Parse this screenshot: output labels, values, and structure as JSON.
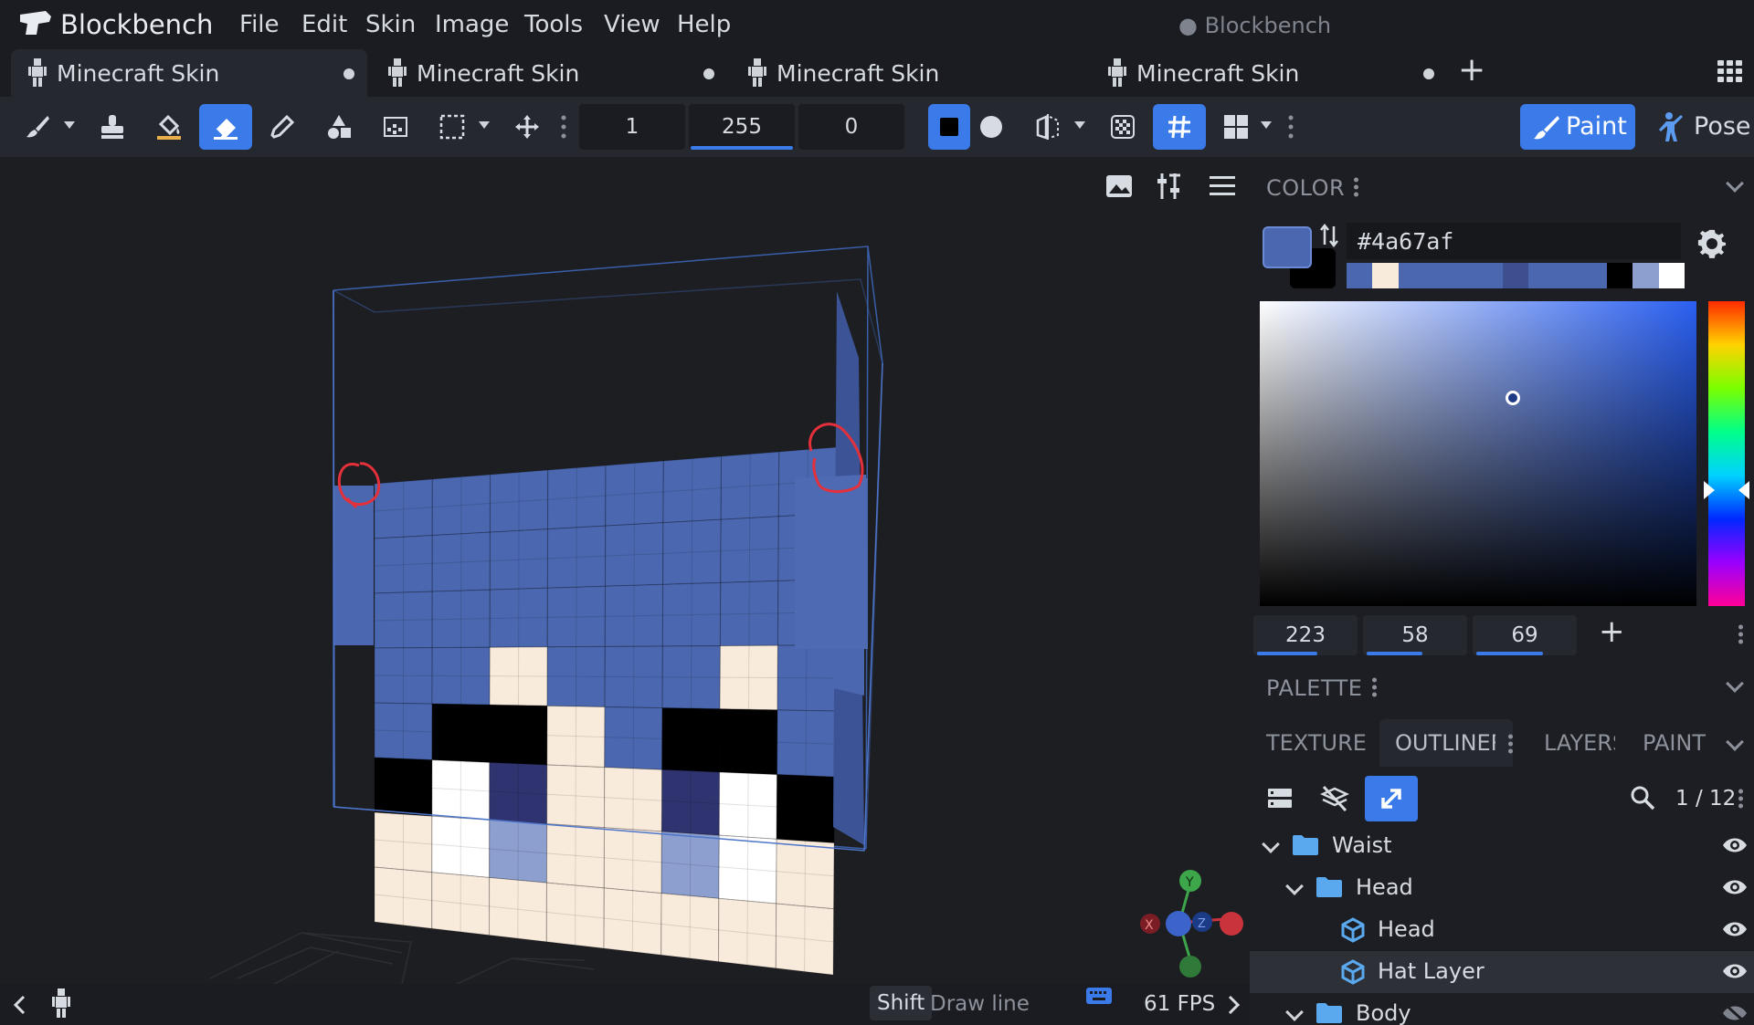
{
  "app": {
    "name": "Blockbench",
    "window_title": "● Blockbench"
  },
  "menu": [
    "File",
    "Edit",
    "Skin",
    "Image",
    "Tools",
    "View",
    "Help"
  ],
  "tabs": [
    {
      "label": "Minecraft Skin",
      "active": true,
      "unsaved": true
    },
    {
      "label": "Minecraft Skin",
      "active": false,
      "unsaved": true
    },
    {
      "label": "Minecraft Skin",
      "active": false,
      "unsaved": false
    },
    {
      "label": "Minecraft Skin",
      "active": false,
      "unsaved": true
    }
  ],
  "toolbar": {
    "brush_size": "1",
    "opacity": "255",
    "softness": "0",
    "opacity_level": 1.0,
    "modes": {
      "paint": "Paint",
      "pose": "Pose"
    }
  },
  "status": {
    "key": "Shift",
    "hint": "Draw line",
    "fps": "61 FPS"
  },
  "gizmo": {
    "x": "X",
    "y": "Y",
    "z": "Z"
  },
  "color_panel": {
    "title": "COLOR",
    "hex": "#4a67af",
    "main_color": "#4a67af",
    "secondary_color": "#000000",
    "history": [
      "#4a67af",
      "#f9ebdc",
      "#4a67af",
      "#4a67af",
      "#4a67af",
      "#4a67af",
      "#3e4f8f",
      "#4a67af",
      "#4a67af",
      "#4a67af",
      "#000000",
      "#8c9fcf",
      "#ffffff"
    ],
    "hsv": {
      "h": "223",
      "s": "58",
      "v": "69"
    },
    "hsv_levels": {
      "h": 0.62,
      "s": 0.58,
      "v": 0.69
    }
  },
  "palette_panel": {
    "title": "PALETTE"
  },
  "panel_tabs": [
    "TEXTURES",
    "OUTLINER",
    "LAYERS",
    "PAINT"
  ],
  "outliner": {
    "count": "1 / 12",
    "rows": [
      {
        "label": "Waist",
        "type": "folder",
        "level": 0,
        "visible": true,
        "selected": false
      },
      {
        "label": "Head",
        "type": "folder",
        "level": 1,
        "visible": true,
        "selected": false
      },
      {
        "label": "Head",
        "type": "cube",
        "level": 2,
        "visible": true,
        "selected": false
      },
      {
        "label": "Hat Layer",
        "type": "cube",
        "level": 2,
        "visible": true,
        "selected": true
      },
      {
        "label": "Body",
        "type": "folder",
        "level": 1,
        "visible": false,
        "selected": false
      }
    ]
  }
}
